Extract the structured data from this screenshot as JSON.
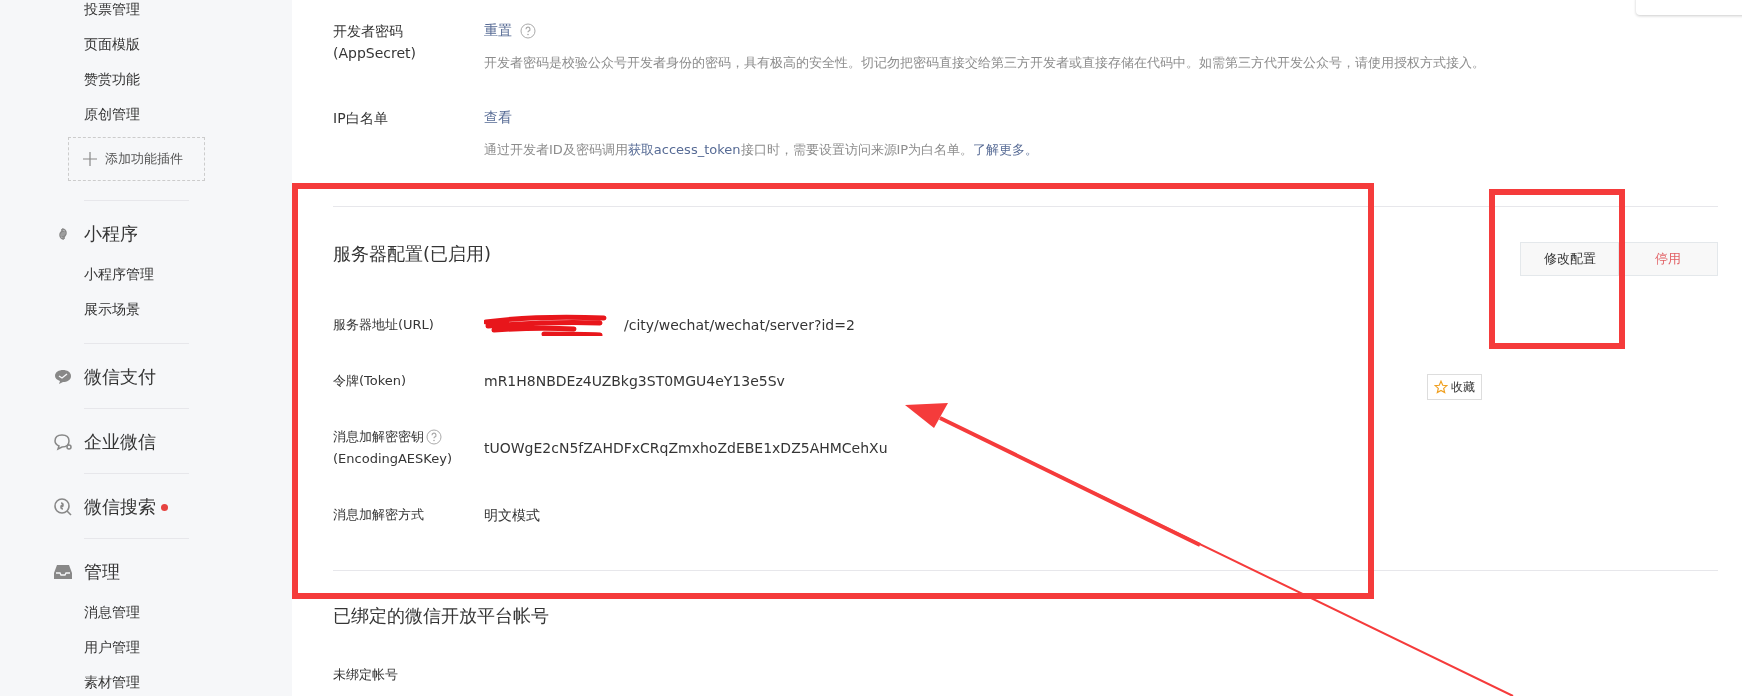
{
  "sidebar": {
    "top_items": [
      "投票管理",
      "页面模版",
      "赞赏功能",
      "原创管理"
    ],
    "add_plugin": "添加功能插件",
    "sections": [
      {
        "title": "小程序",
        "dot": false,
        "items": [
          "小程序管理",
          "展示场景"
        ]
      },
      {
        "title": "微信支付",
        "dot": false
      },
      {
        "title": "企业微信",
        "dot": false
      },
      {
        "title": "微信搜索",
        "dot": true
      },
      {
        "title": "管理",
        "dot": false,
        "items": [
          "消息管理",
          "用户管理",
          "素材管理"
        ]
      }
    ]
  },
  "developer_settings": [
    {
      "label": [
        "开发者密码",
        "(AppSecret)"
      ],
      "action": "重置",
      "help": true,
      "description": [
        {
          "text": "开发者密码是校验公众号开发者身份的密码，具有极高的安全性。切记勿把密码直接交给第三方开发者或直接存储在代码中。如需第三方代开发公众号，请使用授权方式接入。",
          "link": false
        }
      ]
    },
    {
      "label": [
        "IP白名单"
      ],
      "action": "查看",
      "help": false,
      "description": [
        {
          "text": "通过开发者ID及密码调用",
          "link": false
        },
        {
          "text": "获取access_token",
          "link": true
        },
        {
          "text": "接口时，需要设置访问来源IP为白名单。",
          "link": false
        },
        {
          "text": "了解更多。",
          "link": true
        }
      ]
    }
  ],
  "server_config": {
    "title": "服务器配置(已启用)",
    "buttons": [
      {
        "label": "修改配置",
        "kind": "default"
      },
      {
        "label": "停用",
        "kind": "danger"
      }
    ],
    "fields": [
      {
        "label": [
          "服务器地址(URL)"
        ],
        "help": false,
        "redacted": true,
        "value": "/city/wechat/wechat/server?id=2"
      },
      {
        "label": [
          "令牌(Token)"
        ],
        "help": false,
        "redacted": false,
        "value": "mR1H8NBDEz4UZBkg3ST0MGU4eY13e5Sv"
      },
      {
        "label": [
          "消息加解密密钥",
          "(EncodingAESKey)"
        ],
        "help": true,
        "redacted": false,
        "value": "tUOWgE2cN5fZAHDFxCRqZmxhoZdEBE1xDZ5AHMCehXu"
      },
      {
        "label": [
          "消息加解密方式"
        ],
        "help": false,
        "redacted": false,
        "value": "明文模式"
      }
    ]
  },
  "open_platform": {
    "title": "已绑定的微信开放平台帐号",
    "status": "未绑定帐号"
  },
  "favorite_button": {
    "label": "收藏"
  }
}
